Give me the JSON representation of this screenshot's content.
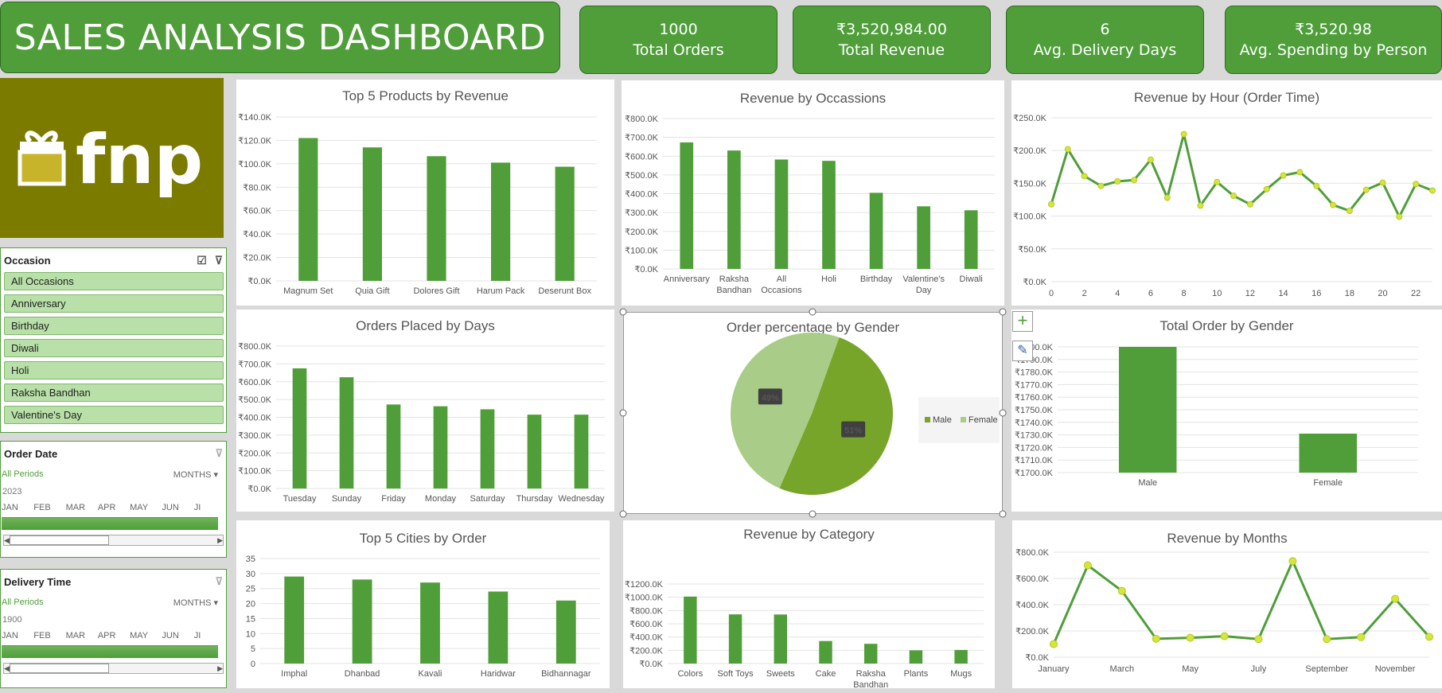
{
  "header": {
    "title": "SALES ANALYSIS DASHBOARD"
  },
  "kpis": [
    {
      "value": "1000",
      "label": "Total Orders"
    },
    {
      "value": "₹3,520,984.00",
      "label": "Total Revenue"
    },
    {
      "value": "6",
      "label": "Avg. Delivery Days"
    },
    {
      "value": "₹3,520.98",
      "label": "Avg. Spending by Person"
    }
  ],
  "logo": {
    "text": "fnp",
    "icon": "gift-icon"
  },
  "slicer_occasion": {
    "title": "Occasion",
    "items": [
      "All Occasions",
      "Anniversary",
      "Birthday",
      "Diwali",
      "Holi",
      "Raksha Bandhan",
      "Valentine's Day"
    ]
  },
  "timeline_order": {
    "title": "Order Date",
    "periods": "All Periods",
    "unit": "MONTHS",
    "year": "2023",
    "months": [
      "JAN",
      "FEB",
      "MAR",
      "APR",
      "MAY",
      "JUN",
      "JI"
    ]
  },
  "timeline_delivery": {
    "title": "Delivery Time",
    "periods": "All Periods",
    "unit": "MONTHS",
    "year": "1900",
    "months": [
      "JAN",
      "FEB",
      "MAR",
      "APR",
      "MAY",
      "JUN",
      "JI"
    ]
  },
  "colors": {
    "bar": "#4f9e3a",
    "line": "#4f9e3a",
    "marker": "#d4e63a",
    "pie_male": "#77a52a",
    "pie_female": "#a9cc88"
  },
  "chart_data": [
    {
      "id": "top-products",
      "type": "bar",
      "title": "Top 5 Products by Revenue",
      "categories": [
        "Magnum Set",
        "Quia Gift",
        "Dolores Gift",
        "Harum Pack",
        "Deserunt Box"
      ],
      "values": [
        122000,
        114000,
        106500,
        101000,
        97500
      ],
      "yticks": [
        "₹0.0K",
        "₹20.0K",
        "₹40.0K",
        "₹60.0K",
        "₹80.0K",
        "₹100.0K",
        "₹120.0K",
        "₹140.0K"
      ],
      "ylim": [
        0,
        140000
      ]
    },
    {
      "id": "occasions",
      "type": "bar",
      "title": "Revenue by Occassions",
      "categories": [
        [
          "Anniversary"
        ],
        [
          "Raksha",
          "Bandhan"
        ],
        [
          "All",
          "Occasions"
        ],
        [
          "Holi"
        ],
        [
          "Birthday"
        ],
        [
          "Valentine's",
          "Day"
        ],
        [
          "Diwali"
        ]
      ],
      "values": [
        673000,
        630000,
        582000,
        575000,
        405000,
        333000,
        312000
      ],
      "yticks": [
        "₹0.0K",
        "₹100.0K",
        "₹200.0K",
        "₹300.0K",
        "₹400.0K",
        "₹500.0K",
        "₹600.0K",
        "₹700.0K",
        "₹800.0K"
      ],
      "ylim": [
        0,
        800000
      ]
    },
    {
      "id": "hour",
      "type": "line",
      "title": "Revenue by Hour (Order Time)",
      "x": [
        0,
        1,
        2,
        3,
        4,
        5,
        6,
        7,
        8,
        9,
        10,
        11,
        12,
        13,
        14,
        15,
        16,
        17,
        18,
        19,
        20,
        21,
        22,
        23
      ],
      "values": [
        118000,
        202000,
        161000,
        146000,
        153000,
        155000,
        186000,
        128000,
        225000,
        116000,
        152000,
        131000,
        118000,
        141000,
        162000,
        167000,
        146000,
        117000,
        108000,
        140000,
        151000,
        99000,
        149000,
        139000
      ],
      "xticks": [
        "0",
        "2",
        "4",
        "6",
        "8",
        "10",
        "12",
        "14",
        "16",
        "18",
        "20",
        "22"
      ],
      "yticks": [
        "₹0.0K",
        "₹50.0K",
        "₹100.0K",
        "₹150.0K",
        "₹200.0K",
        "₹250.0K"
      ],
      "ylim": [
        0,
        250000
      ]
    },
    {
      "id": "days",
      "type": "bar",
      "title": "Orders Placed by Days",
      "categories": [
        "Tuesday",
        "Sunday",
        "Friday",
        "Monday",
        "Saturday",
        "Thursday",
        "Wednesday"
      ],
      "values": [
        675000,
        625000,
        472000,
        462000,
        445000,
        415000,
        415000
      ],
      "yticks": [
        "₹0.0K",
        "₹100.0K",
        "₹200.0K",
        "₹300.0K",
        "₹400.0K",
        "₹500.0K",
        "₹600.0K",
        "₹700.0K",
        "₹800.0K"
      ],
      "ylim": [
        0,
        800000
      ]
    },
    {
      "id": "gender-pie",
      "type": "pie",
      "title": "Order percentage by Gender",
      "labels": [
        "Male",
        "Female"
      ],
      "values": [
        51,
        49
      ],
      "data_labels": [
        "51%",
        "49%"
      ]
    },
    {
      "id": "gender-bar",
      "type": "bar",
      "title": "Total Order by Gender",
      "categories": [
        "Male",
        "Female"
      ],
      "values": [
        1800000,
        1731000
      ],
      "yticks": [
        "₹1700.0K",
        "₹1710.0K",
        "₹1720.0K",
        "₹1730.0K",
        "₹1740.0K",
        "₹1750.0K",
        "₹1760.0K",
        "₹1770.0K",
        "₹1780.0K",
        "₹1790.0K",
        "₹1800.0K"
      ],
      "ylim": [
        1700000,
        1800000
      ]
    },
    {
      "id": "cities",
      "type": "bar",
      "title": "Top 5 Cities by Order",
      "categories": [
        "Imphal",
        "Dhanbad",
        "Kavali",
        "Haridwar",
        "Bidhannagar"
      ],
      "values": [
        29,
        28,
        27,
        24,
        21
      ],
      "yticks": [
        "0",
        "5",
        "10",
        "15",
        "20",
        "25",
        "30",
        "35"
      ],
      "ylim": [
        0,
        35
      ]
    },
    {
      "id": "category",
      "type": "bar",
      "title": "Revenue by Category",
      "categories": [
        [
          "Colors"
        ],
        [
          "Soft Toys"
        ],
        [
          "Sweets"
        ],
        [
          "Cake"
        ],
        [
          "Raksha",
          "Bandhan"
        ],
        [
          "Plants"
        ],
        [
          "Mugs"
        ]
      ],
      "values": [
        1010000,
        742000,
        740000,
        340000,
        298000,
        200000,
        205000
      ],
      "yticks": [
        "₹0.0K",
        "₹200.0K",
        "₹400.0K",
        "₹600.0K",
        "₹800.0K",
        "₹1000.0K",
        "₹1200.0K"
      ],
      "ylim": [
        0,
        1200000
      ]
    },
    {
      "id": "months",
      "type": "line",
      "title": "Revenue by Months",
      "x": [
        "January",
        "February",
        "March",
        "April",
        "May",
        "June",
        "July",
        "August",
        "September",
        "October",
        "November",
        "December"
      ],
      "values": [
        100000,
        700000,
        505000,
        140000,
        148000,
        160000,
        138000,
        732000,
        138000,
        153000,
        445000,
        155000
      ],
      "xticks": [
        "January",
        "",
        "March",
        "",
        "May",
        "",
        "July",
        "",
        "September",
        "",
        "November",
        ""
      ],
      "yticks": [
        "₹0.0K",
        "₹200.0K",
        "₹400.0K",
        "₹600.0K",
        "₹800.0K"
      ],
      "ylim": [
        0,
        800000
      ]
    }
  ]
}
